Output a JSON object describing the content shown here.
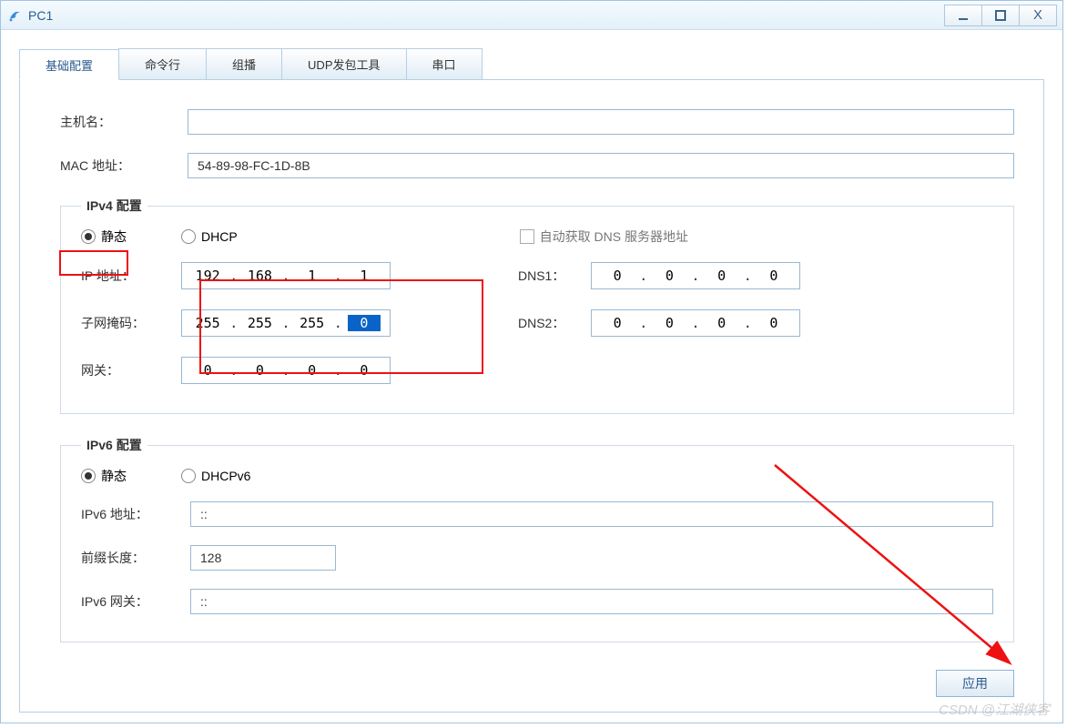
{
  "window": {
    "title": "PC1"
  },
  "tabs": [
    "基础配置",
    "命令行",
    "组播",
    "UDP发包工具",
    "串口"
  ],
  "basic": {
    "hostname_label": "主机名：",
    "hostname": "",
    "mac_label": "MAC 地址：",
    "mac": "54-89-98-FC-1D-8B"
  },
  "ipv4": {
    "legend": "IPv4 配置",
    "static_label": "静态",
    "dhcp_label": "DHCP",
    "auto_dns_label": "自动获取 DNS 服务器地址",
    "ip_label": "IP 地址：",
    "ip": [
      "192",
      "168",
      "1",
      "1"
    ],
    "mask_label": "子网掩码：",
    "mask": [
      "255",
      "255",
      "255",
      "0"
    ],
    "gw_label": "网关：",
    "gw": [
      "0",
      "0",
      "0",
      "0"
    ],
    "dns1_label": "DNS1：",
    "dns1": [
      "0",
      "0",
      "0",
      "0"
    ],
    "dns2_label": "DNS2：",
    "dns2": [
      "0",
      "0",
      "0",
      "0"
    ]
  },
  "ipv6": {
    "legend": "IPv6 配置",
    "static_label": "静态",
    "dhcp_label": "DHCPv6",
    "addr_label": "IPv6 地址：",
    "addr": "::",
    "prefix_label": "前缀长度：",
    "prefix": "128",
    "gw_label": "IPv6 网关：",
    "gw": "::"
  },
  "apply_label": "应用",
  "watermark": "CSDN @江湖侠客"
}
